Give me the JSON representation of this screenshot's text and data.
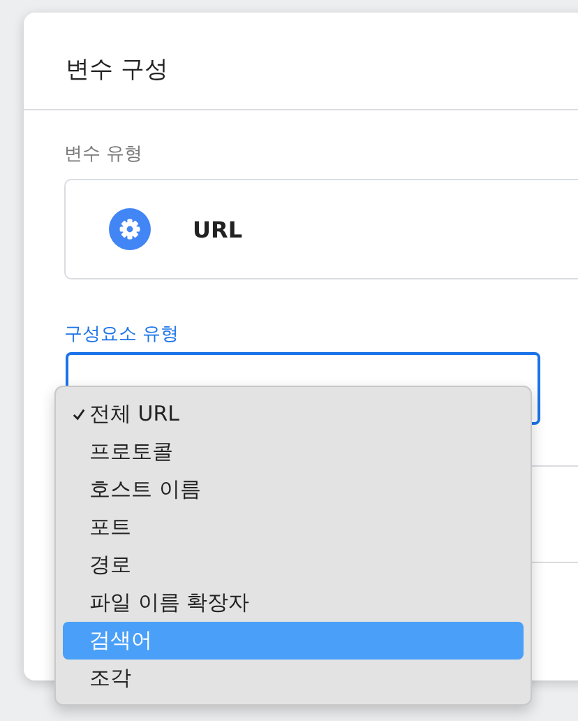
{
  "dialog": {
    "title": "변수 구성"
  },
  "variable_type": {
    "label": "변수 유형",
    "value": "URL"
  },
  "component_type": {
    "label": "구성요소 유형"
  },
  "dropdown": {
    "items": [
      {
        "label": "전체 URL",
        "checked": true,
        "selected": false
      },
      {
        "label": "프로토콜",
        "checked": false,
        "selected": false
      },
      {
        "label": "호스트 이름",
        "checked": false,
        "selected": false
      },
      {
        "label": "포트",
        "checked": false,
        "selected": false
      },
      {
        "label": "경로",
        "checked": false,
        "selected": false
      },
      {
        "label": "파일 이름 확장자",
        "checked": false,
        "selected": false
      },
      {
        "label": "검색어",
        "checked": false,
        "selected": true
      },
      {
        "label": "조각",
        "checked": false,
        "selected": false
      }
    ]
  }
}
